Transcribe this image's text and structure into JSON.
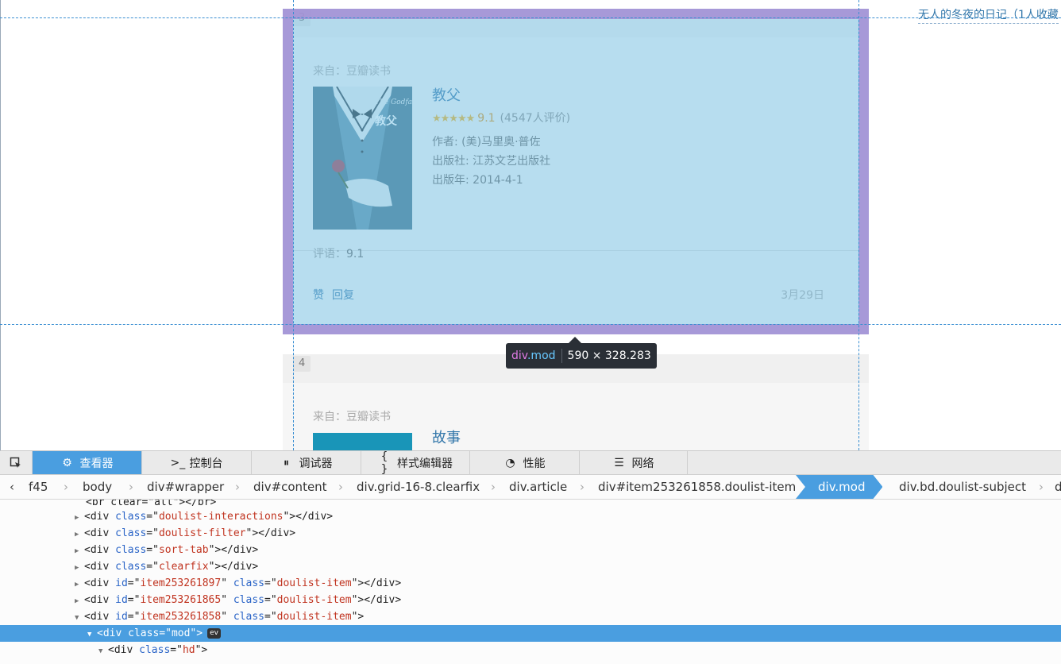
{
  "page": {
    "top_link": "无人的冬夜的日记（1人收藏",
    "cards": [
      {
        "number": "3",
        "source": "来自：豆瓣读书",
        "book": {
          "title": "教父",
          "cover_title_en": "The Godfather",
          "cover_title_cn": "教父",
          "stars": "★★★★★",
          "score": "9.1",
          "votes": "(4547人评价)",
          "author": "作者: (美)马里奥·普佐",
          "publisher": "出版社: 江苏文艺出版社",
          "year": "出版年: 2014-4-1"
        },
        "review_label": "评语：",
        "review_value": "9.1",
        "actions": [
          "赞",
          "回复"
        ],
        "date": "3月29日"
      },
      {
        "number": "4",
        "source": "来自：豆瓣读书",
        "book": {
          "title": "故事"
        }
      }
    ]
  },
  "inspector_tooltip": {
    "tag": "div",
    "class": ".mod",
    "size": "590 × 328.283"
  },
  "devtools": {
    "tabs": [
      {
        "label": "查看器",
        "icon": "inspector-icon",
        "active": true
      },
      {
        "label": "控制台",
        "icon": "console-icon",
        "active": false
      },
      {
        "label": "调试器",
        "icon": "debugger-icon",
        "active": false
      },
      {
        "label": "样式编辑器",
        "icon": "style-editor-icon",
        "active": false
      },
      {
        "label": "性能",
        "icon": "performance-icon",
        "active": false
      },
      {
        "label": "网络",
        "icon": "network-icon",
        "active": false
      }
    ],
    "breadcrumbs": [
      "f45",
      "body",
      "div#wrapper",
      "div#content",
      "div.grid-16-8.clearfix",
      "div.article",
      "div#item253261858.doulist-item",
      "div.mod",
      "div.bd.doulist-subject",
      "d"
    ],
    "selected_breadcrumb": "div.mod",
    "markup_lines": [
      {
        "partial": "<br clear=\"all\"></br>"
      },
      {
        "tag": "div",
        "attr": "class",
        "value": "doulist-interactions",
        "collapsed": true
      },
      {
        "tag": "div",
        "attr": "class",
        "value": "doulist-filter",
        "collapsed": true
      },
      {
        "tag": "div",
        "attr": "class",
        "value": "sort-tab",
        "collapsed": true
      },
      {
        "tag": "div",
        "attr": "class",
        "value": "clearfix",
        "collapsed": true
      },
      {
        "tag": "div",
        "id": "item253261897",
        "attr": "class",
        "value": "doulist-item",
        "collapsed": true
      },
      {
        "tag": "div",
        "id": "item253261865",
        "attr": "class",
        "value": "doulist-item",
        "collapsed": true
      },
      {
        "tag": "div",
        "id": "item253261858",
        "attr": "class",
        "value": "doulist-item",
        "collapsed": false
      },
      {
        "tag": "div",
        "attr": "class",
        "value": "mod",
        "collapsed": false,
        "selected": true,
        "badge": "ev"
      },
      {
        "tag": "div",
        "attr": "class",
        "value": "hd",
        "collapsed": false
      }
    ]
  }
}
